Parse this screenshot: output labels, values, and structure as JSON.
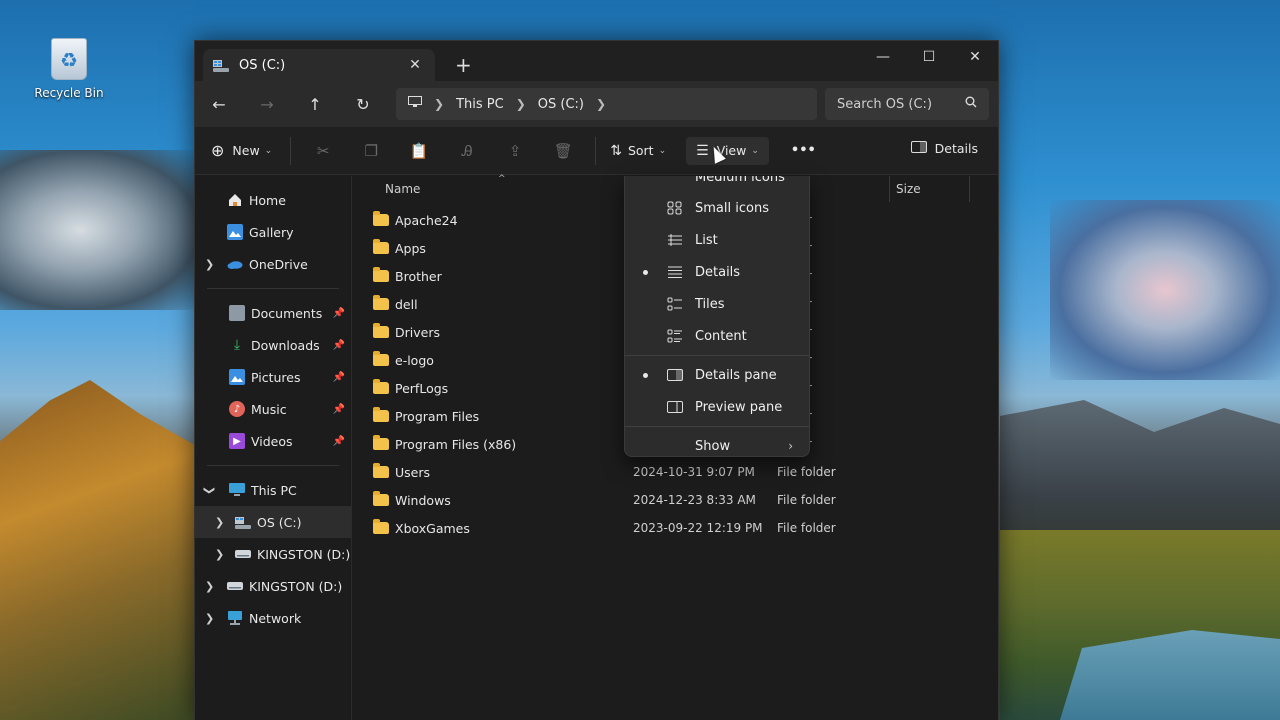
{
  "desktop": {
    "recycle_bin_label": "Recycle Bin"
  },
  "window": {
    "tab_title": "OS (C:)",
    "new_tab_glyph": "+",
    "controls": {
      "minimize": "—",
      "maximize": "☐",
      "close": "✕"
    }
  },
  "nav": {
    "back": "←",
    "forward": "→",
    "up": "↑",
    "refresh": "↻",
    "breadcrumb": [
      "This PC",
      "OS (C:)"
    ],
    "search_placeholder": "Search OS (C:)"
  },
  "toolbar": {
    "new_label": "New",
    "sort_label": "Sort",
    "view_label": "View",
    "more_glyph": "•••",
    "details_label": "Details"
  },
  "sidebar": {
    "quick": [
      {
        "label": "Home",
        "icon": "home-icon",
        "color": "#e8e8e8"
      },
      {
        "label": "Gallery",
        "icon": "gallery-icon",
        "color": "#3b8fe0"
      },
      {
        "label": "OneDrive",
        "icon": "cloud-icon",
        "color": "#3b8fe0"
      }
    ],
    "pinned": [
      {
        "label": "Documents",
        "icon": "document-icon"
      },
      {
        "label": "Downloads",
        "icon": "download-icon"
      },
      {
        "label": "Pictures",
        "icon": "picture-icon"
      },
      {
        "label": "Music",
        "icon": "music-icon"
      },
      {
        "label": "Videos",
        "icon": "video-icon"
      }
    ],
    "devices": [
      {
        "label": "This PC",
        "icon": "computer-icon"
      },
      {
        "label": "OS (C:)",
        "icon": "drive-icon"
      },
      {
        "label": "KINGSTON (D:)",
        "icon": "usb-drive-icon"
      },
      {
        "label": "KINGSTON (D:)",
        "icon": "usb-drive-icon"
      },
      {
        "label": "Network",
        "icon": "network-icon"
      }
    ]
  },
  "list": {
    "columns": {
      "name": "Name",
      "size": "Size"
    },
    "rows": [
      {
        "name": "Apache24",
        "date": "",
        "type": "folder"
      },
      {
        "name": "Apps",
        "date": "",
        "type": "folder"
      },
      {
        "name": "Brother",
        "date": "",
        "type": "folder"
      },
      {
        "name": "dell",
        "date": "",
        "type": "folder"
      },
      {
        "name": "Drivers",
        "date": "",
        "type": "folder"
      },
      {
        "name": "e-logo",
        "date": "",
        "type": "folder"
      },
      {
        "name": "PerfLogs",
        "date": "",
        "type": "folder"
      },
      {
        "name": "Program Files",
        "date": "",
        "type": "folder"
      },
      {
        "name": "Program Files (x86)",
        "date": "",
        "type": "folder"
      },
      {
        "name": "Users",
        "date": "2024-10-31 9:07 PM",
        "type": "File folder"
      },
      {
        "name": "Windows",
        "date": "2024-12-23 8:33 AM",
        "type": "File folder"
      },
      {
        "name": "XboxGames",
        "date": "2023-09-22 12:19 PM",
        "type": "File folder"
      }
    ]
  },
  "view_menu": {
    "partial_item": "Medium icons",
    "layouts": [
      {
        "label": "Small icons",
        "icon": "small-icons-icon",
        "selected": false
      },
      {
        "label": "List",
        "icon": "list-icon",
        "selected": false
      },
      {
        "label": "Details",
        "icon": "details-icon",
        "selected": true
      },
      {
        "label": "Tiles",
        "icon": "tiles-icon",
        "selected": false
      },
      {
        "label": "Content",
        "icon": "content-icon",
        "selected": false
      }
    ],
    "panes": [
      {
        "label": "Details pane",
        "icon": "details-pane-icon",
        "selected": true
      },
      {
        "label": "Preview pane",
        "icon": "preview-pane-icon",
        "selected": false
      }
    ],
    "show_label": "Show",
    "show_arrow": "›"
  }
}
